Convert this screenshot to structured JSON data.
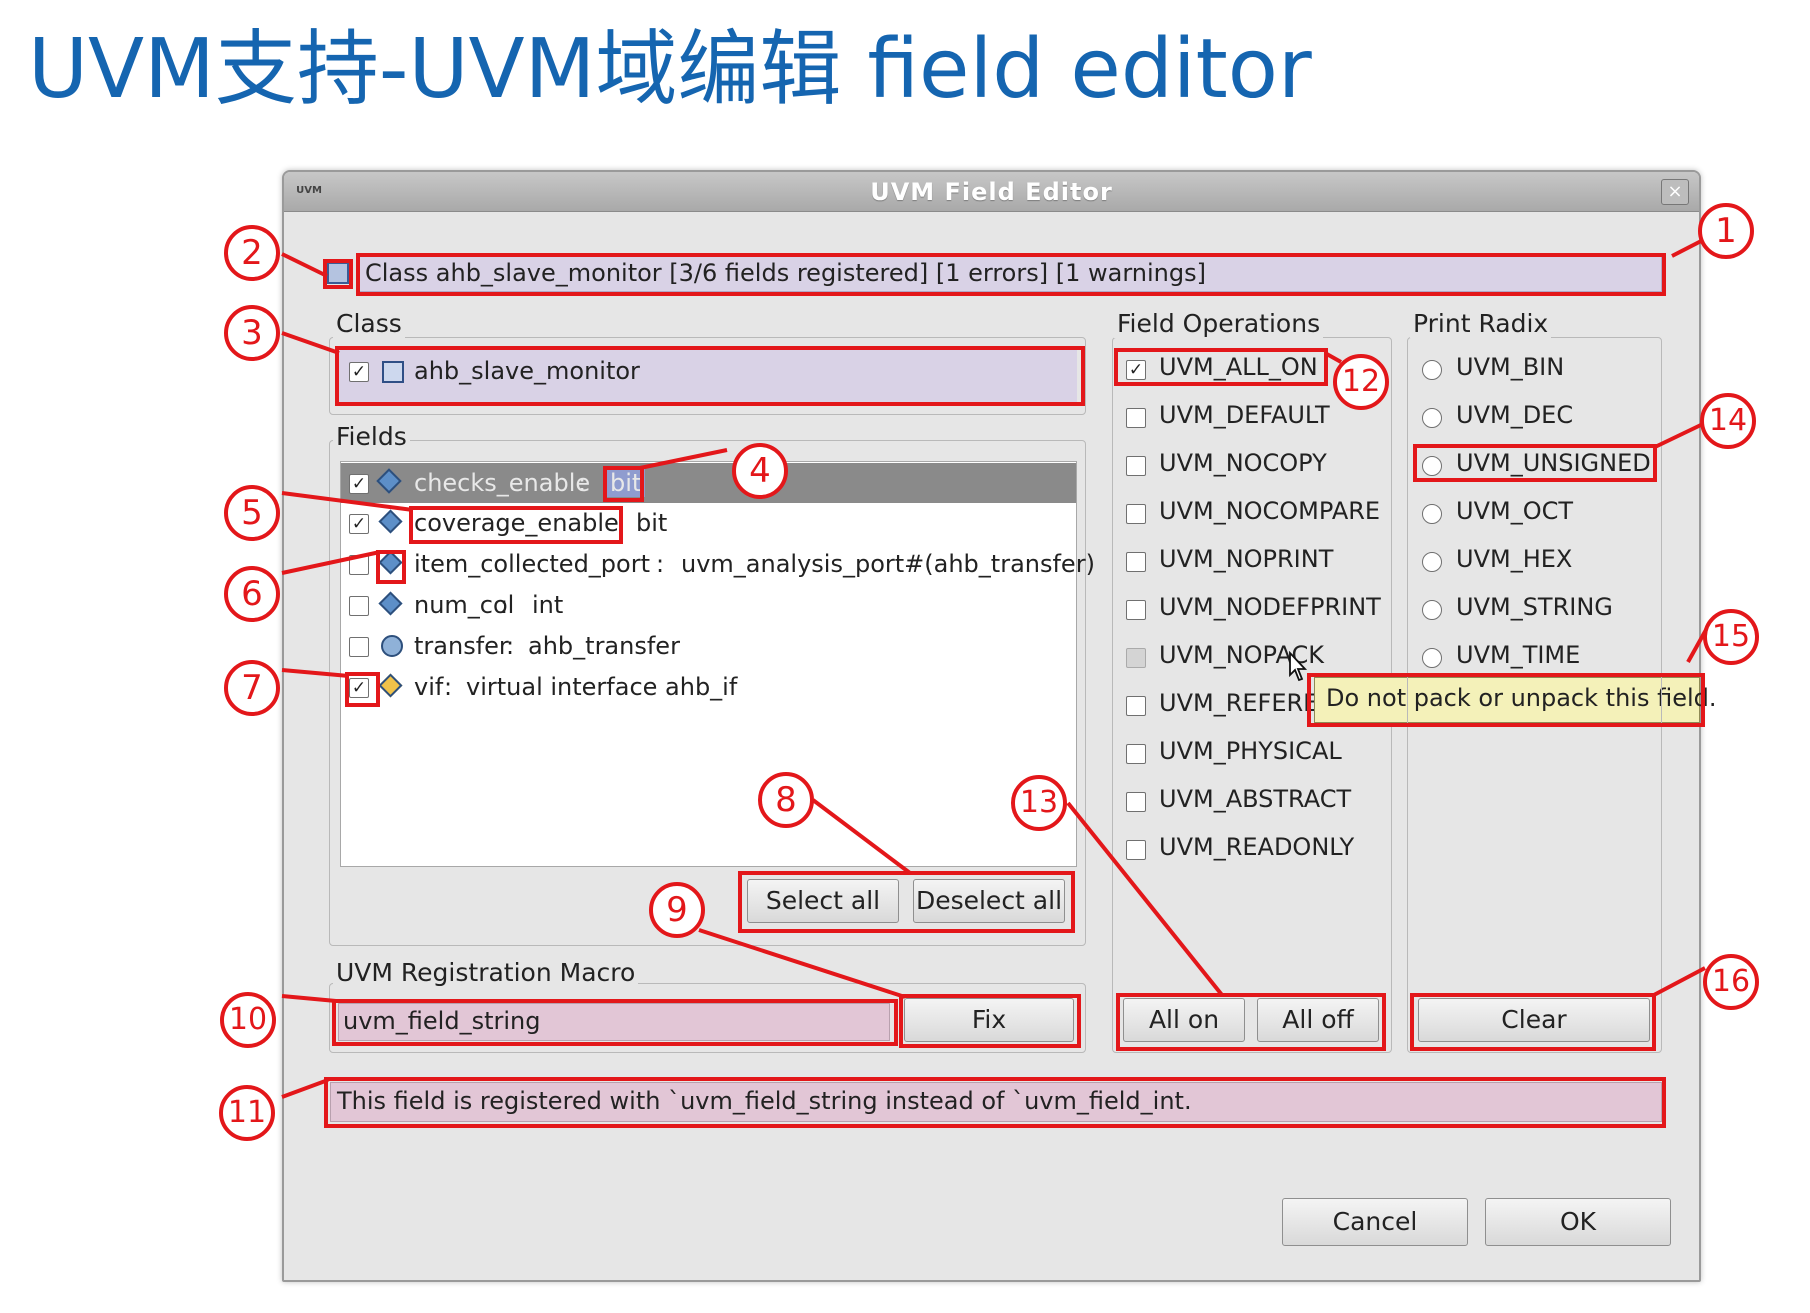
{
  "slide_title": "UVM支持-UVM域编辑 field editor",
  "dialog": {
    "title": "UVM Field Editor",
    "app_icon": "UVM",
    "close_glyph": "×"
  },
  "status": {
    "text": "Class ahb_slave_monitor  [3/6 fields registered]  [1 errors]  [1 warnings]"
  },
  "class_group": {
    "label": "Class",
    "item": "ahb_slave_monitor"
  },
  "fields_group": {
    "label": "Fields",
    "items": [
      {
        "name": "checks_enable",
        "sep": " : ",
        "type": "bit",
        "checked": true,
        "selected": true,
        "icon": "field-error-icon"
      },
      {
        "name": "coverage_enable",
        "sep": " ",
        "type": "bit",
        "checked": true,
        "selected": false,
        "icon": "field-icon"
      },
      {
        "name": "item_collected_port",
        "sep": " : ",
        "type": "uvm_analysis_port#(ahb_transfer)",
        "checked": false,
        "selected": false,
        "icon": "field-warning-icon"
      },
      {
        "name": "num_col",
        "sep": " : ",
        "type": "int",
        "checked": false,
        "selected": false,
        "icon": "field-icon"
      },
      {
        "name": "transfer",
        "sep": " : ",
        "type": "ahb_transfer",
        "checked": false,
        "selected": false,
        "icon": "object-icon"
      },
      {
        "name": "vif",
        "sep": " : ",
        "type": "virtual interface ahb_if",
        "checked": true,
        "selected": false,
        "icon": "interface-icon"
      }
    ],
    "select_all": "Select all",
    "deselect_all": "Deselect all"
  },
  "macro_group": {
    "label": "UVM Registration Macro",
    "value": "uvm_field_string",
    "fix": "Fix"
  },
  "message": "This field is registered with `uvm_field_string instead of `uvm_field_int.",
  "field_ops": {
    "label": "Field Operations",
    "items": [
      {
        "label": "UVM_ALL_ON",
        "checked": true
      },
      {
        "label": "UVM_DEFAULT",
        "checked": false
      },
      {
        "label": "UVM_NOCOPY",
        "checked": false
      },
      {
        "label": "UVM_NOCOMPARE",
        "checked": false
      },
      {
        "label": "UVM_NOPRINT",
        "checked": false
      },
      {
        "label": "UVM_NODEFPRINT",
        "checked": false
      },
      {
        "label": "UVM_NOPACK",
        "checked": false,
        "disabled": true
      },
      {
        "label": "UVM_REFERE",
        "checked": false
      },
      {
        "label": "UVM_PHYSICAL",
        "checked": false
      },
      {
        "label": "UVM_ABSTRACT",
        "checked": false
      },
      {
        "label": "UVM_READONLY",
        "checked": false
      }
    ],
    "all_on": "All on",
    "all_off": "All off"
  },
  "tooltip": "Do not pack or unpack this field.",
  "print_radix": {
    "label": "Print Radix",
    "items": [
      "UVM_BIN",
      "UVM_DEC",
      "UVM_UNSIGNED",
      "UVM_OCT",
      "UVM_HEX",
      "UVM_STRING",
      "UVM_TIME"
    ],
    "clear": "Clear"
  },
  "footer": {
    "cancel": "Cancel",
    "ok": "OK"
  },
  "annotations": [
    "1",
    "2",
    "3",
    "4",
    "5",
    "6",
    "7",
    "8",
    "9",
    "10",
    "11",
    "12",
    "13",
    "14",
    "15",
    "16"
  ],
  "colors": {
    "annotation_red": "#e3171a",
    "title_blue": "#1565b0",
    "status_bg": "#d9d2e6",
    "error_bg": "#e2c6d6",
    "selected_row": "#8a8a8a",
    "tooltip_bg": "#f4f1b9"
  }
}
